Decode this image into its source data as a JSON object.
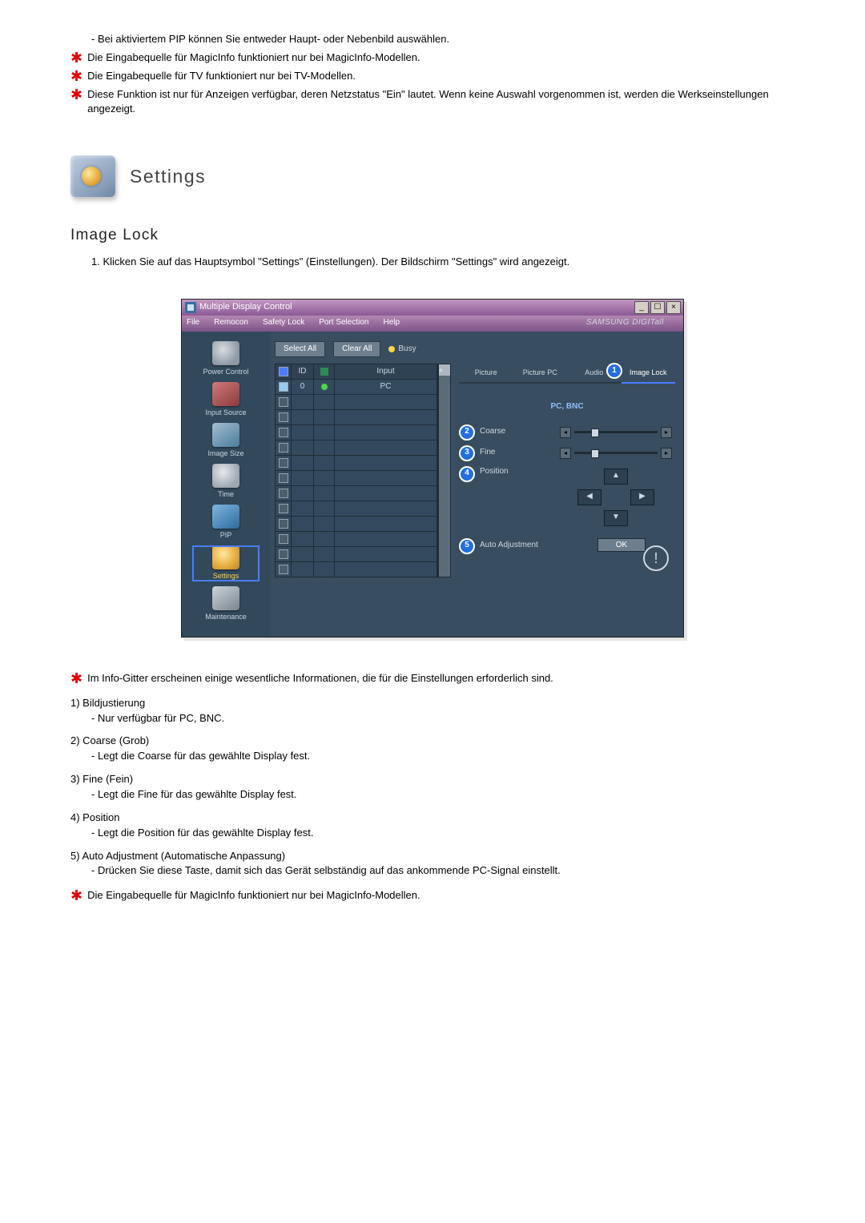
{
  "top_notes": {
    "pip_sub": "- Bei aktiviertem PIP können Sie entweder Haupt- oder Nebenbild auswählen.",
    "star1": "Die Eingabequelle für MagicInfo funktioniert nur bei MagicInfo-Modellen.",
    "star2": "Die Eingabequelle für TV funktioniert nur bei TV-Modellen.",
    "star3": "Diese Funktion ist nur für Anzeigen verfügbar, deren Netzstatus \"Ein\" lautet. Wenn keine Auswahl vorgenommen ist, werden die Werkseinstellungen angezeigt."
  },
  "heading": "Settings",
  "subheading": "Image Lock",
  "step1": "1.  Klicken Sie auf das Hauptsymbol \"Settings\" (Einstellungen). Der Bildschirm \"Settings\" wird angezeigt.",
  "app": {
    "title": "Multiple Display Control",
    "menu": {
      "file": "File",
      "remocon": "Remocon",
      "safety": "Safety Lock",
      "port": "Port Selection",
      "help": "Help"
    },
    "brand": "SAMSUNG DIGITall",
    "side": {
      "power": "Power Control",
      "input": "Input Source",
      "image": "Image Size",
      "time": "Time",
      "pip": "PIP",
      "settings": "Settings",
      "maint": "Maintenance"
    },
    "toolbar": {
      "select": "Select All",
      "clear": "Clear All",
      "busy": "Busy"
    },
    "grid": {
      "h_id": "ID",
      "h_input": "Input",
      "row0_id": "0",
      "row0_input": "PC"
    },
    "tabs": {
      "picture": "Picture",
      "picturepc": "Picture PC",
      "audio": "Audio",
      "imagelock": "Image Lock"
    },
    "mode": "PC, BNC",
    "labels": {
      "coarse": "Coarse",
      "fine": "Fine",
      "position": "Position",
      "auto": "Auto Adjustment",
      "ok": "OK"
    },
    "badges": {
      "b1": "1",
      "b2": "2",
      "b3": "3",
      "b4": "4",
      "b5": "5"
    }
  },
  "info_star": "Im Info-Gitter erscheinen einige wesentliche Informationen, die für die Einstellungen erforderlich sind.",
  "list": {
    "i1_head": "1)  Bildjustierung",
    "i1_sub": "- Nur verfügbar für PC, BNC.",
    "i2_head": "2)  Coarse (Grob)",
    "i2_sub": "- Legt die Coarse für das gewählte Display fest.",
    "i3_head": "3)  Fine (Fein)",
    "i3_sub": "- Legt die Fine für das gewählte Display fest.",
    "i4_head": "4)  Position",
    "i4_sub": "- Legt die Position für das gewählte Display fest.",
    "i5_head": "5)  Auto Adjustment (Automatische Anpassung)",
    "i5_sub": "- Drücken Sie diese Taste, damit sich das Gerät selbständig auf das ankommende PC-Signal einstellt."
  },
  "bottom_star": "Die Eingabequelle für MagicInfo funktioniert nur bei MagicInfo-Modellen."
}
